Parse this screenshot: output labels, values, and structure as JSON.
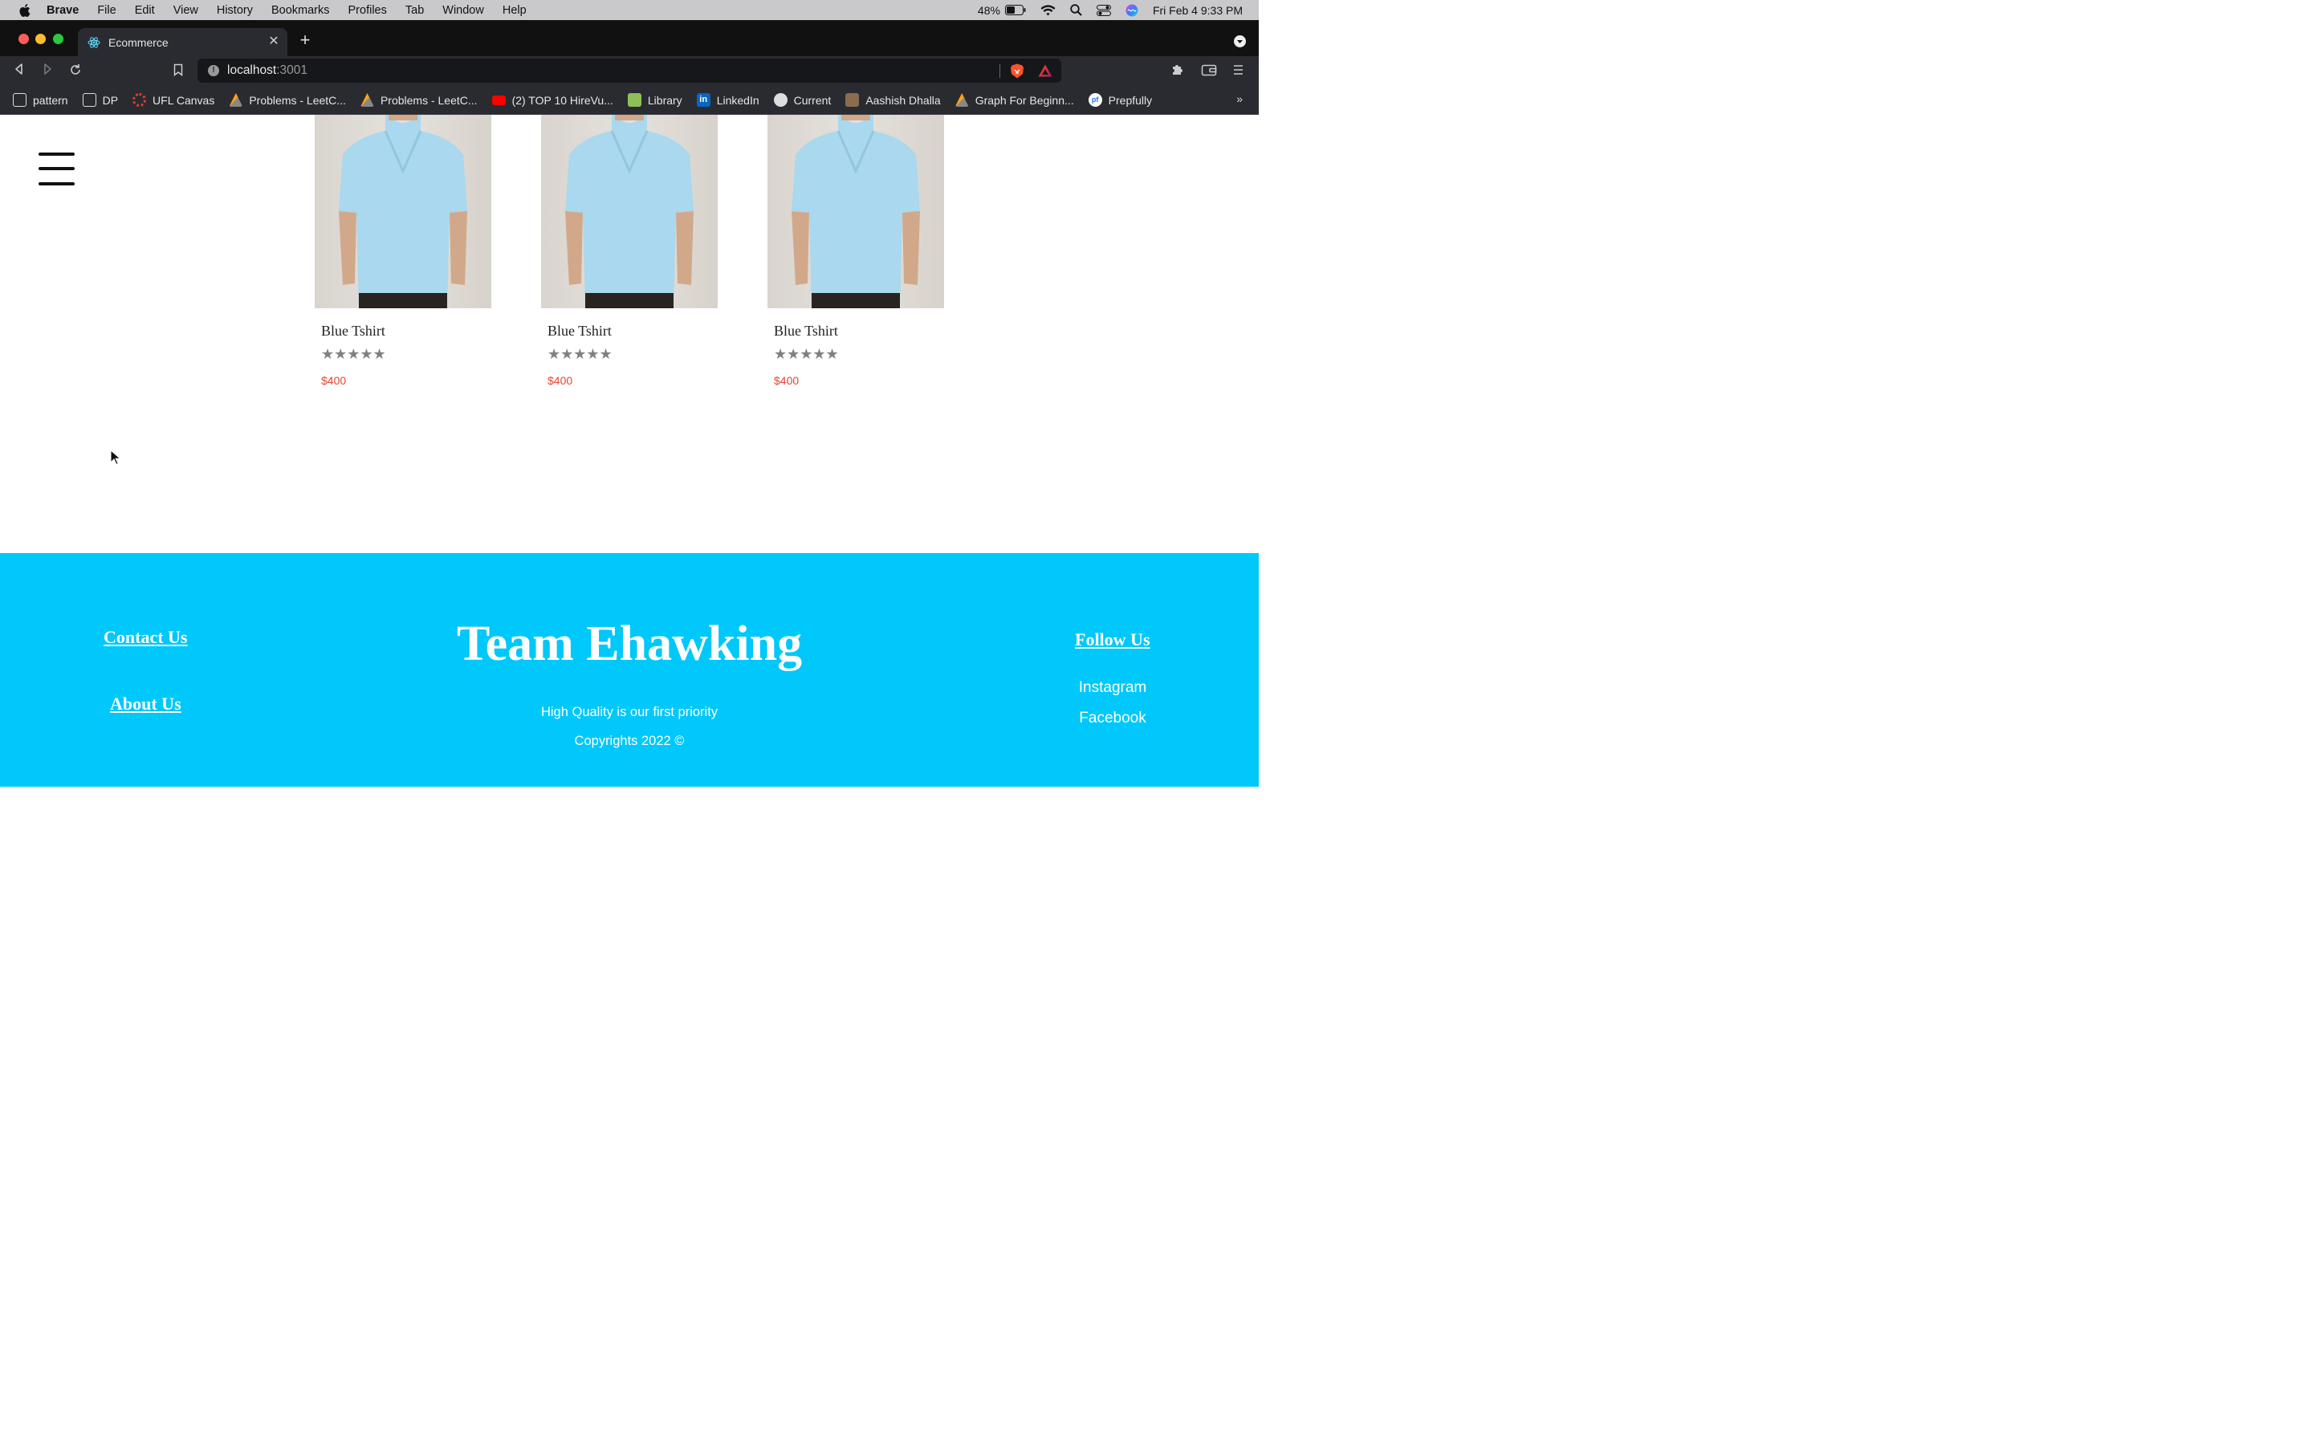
{
  "menubar": {
    "app": "Brave",
    "items": [
      "File",
      "Edit",
      "View",
      "History",
      "Bookmarks",
      "Profiles",
      "Tab",
      "Window",
      "Help"
    ],
    "battery": "48%",
    "datetime": "Fri Feb 4  9:33 PM"
  },
  "browser": {
    "tab_title": "Ecommerce",
    "url_host": "localhost",
    "url_port": ":3001"
  },
  "bookmarks": [
    {
      "label": "pattern",
      "icon": "terminal-icon"
    },
    {
      "label": "DP",
      "icon": "terminal-icon"
    },
    {
      "label": "UFL Canvas",
      "icon": "canvas-icon"
    },
    {
      "label": "Problems - LeetC...",
      "icon": "leetcode-icon"
    },
    {
      "label": "Problems - LeetC...",
      "icon": "leetcode-icon"
    },
    {
      "label": "(2) TOP 10 HireVu...",
      "icon": "youtube-icon"
    },
    {
      "label": "Library",
      "icon": "library-icon"
    },
    {
      "label": "LinkedIn",
      "icon": "linkedin-icon"
    },
    {
      "label": "Current",
      "icon": "globe-icon"
    },
    {
      "label": "Aashish Dhalla",
      "icon": "avatar-icon"
    },
    {
      "label": "Graph For Beginn...",
      "icon": "leetcode-icon"
    },
    {
      "label": "Prepfully",
      "icon": "prepfully-icon"
    }
  ],
  "products": [
    {
      "name": "Blue Tshirt",
      "rating": 0,
      "stars": "★★★★★",
      "price": "$400"
    },
    {
      "name": "Blue Tshirt",
      "rating": 0,
      "stars": "★★★★★",
      "price": "$400"
    },
    {
      "name": "Blue Tshirt",
      "rating": 0,
      "stars": "★★★★★",
      "price": "$400"
    }
  ],
  "footer": {
    "contact": "Contact Us",
    "about": "About Us",
    "brand": "Team Ehawking",
    "tagline": "High Quality is our first priority",
    "copyright": "Copyrights 2022 ©",
    "follow": "Follow Us",
    "instagram": "Instagram",
    "facebook": "Facebook"
  },
  "colors": {
    "footer_bg": "#00c8fa",
    "price": "#e8442e",
    "star": "#808080"
  }
}
